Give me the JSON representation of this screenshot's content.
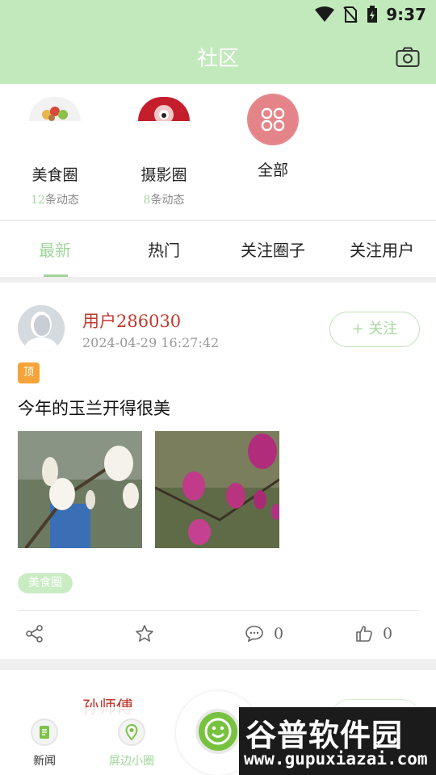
{
  "status_bar": {
    "time": "9:37"
  },
  "header": {
    "title": "社区",
    "camera_icon": "camera-icon"
  },
  "circles": [
    {
      "name": "美食圈",
      "count": "12",
      "count_suffix": "条动态"
    },
    {
      "name": "摄影圈",
      "count": "8",
      "count_suffix": "条动态"
    },
    {
      "name": "全部"
    }
  ],
  "tabs": [
    {
      "label": "最新",
      "active": true
    },
    {
      "label": "热门"
    },
    {
      "label": "关注圈子"
    },
    {
      "label": "关注用户"
    }
  ],
  "post": {
    "username": "用户286030",
    "time": "2024-04-29 16:27:42",
    "follow_label": "+ 关注",
    "pin_label": "顶",
    "content": "今年的玉兰开得很美",
    "tag": "美食圈",
    "comments": "0",
    "likes": "0"
  },
  "post2": {
    "username": "孙师傅"
  },
  "bottom_nav": [
    {
      "label": "新闻",
      "icon": "news-icon"
    },
    {
      "label": "屏边小圈",
      "icon": "location-icon",
      "active": true
    }
  ],
  "watermark": {
    "brand": "谷普软件园",
    "url": "www.gupuxiazai.com"
  },
  "colors": {
    "header": "#c2e9bc",
    "accent": "#9fd598",
    "username": "#c2392d",
    "pin": "#f5a43a"
  }
}
